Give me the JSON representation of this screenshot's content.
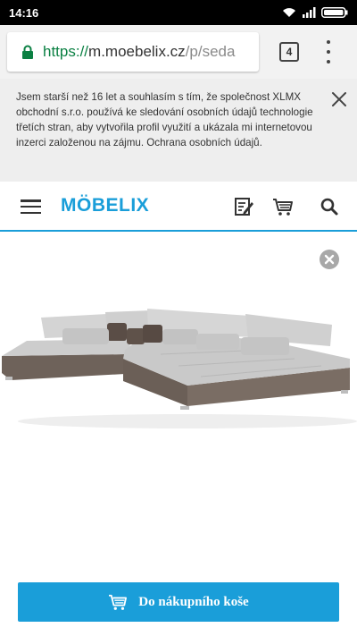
{
  "status_bar": {
    "time": "14:16",
    "icons": [
      "wifi-icon",
      "signal-icon",
      "battery-icon"
    ]
  },
  "browser": {
    "url_scheme": "https://",
    "url_host": "m.moebelix.cz",
    "url_path": "/p/seda",
    "tab_count": "4",
    "icons": [
      "lock-icon",
      "overflow-menu-icon"
    ]
  },
  "cookie_banner": {
    "text": "Jsem starší než 16 let a souhlasím s tím, že společnost XLMX obchodní s.r.o. používá ke sledování osobních údajů technologie třetích stran, aby vytvořila profil využití a ukázala mi internetovou inzerci založenou na zájmu. Ochrana osobních údajů.",
    "close_icon": "close-icon"
  },
  "header": {
    "logo": "MÖBELIX",
    "icons": [
      "hamburger-menu-icon",
      "notepad-icon",
      "cart-icon",
      "search-icon"
    ]
  },
  "product": {
    "close_icon": "close-circle-icon",
    "image": "corner-sofa-image"
  },
  "cart_button": {
    "label": "Do nákupního koše",
    "icon": "cart-icon"
  },
  "colors": {
    "accent": "#1a9ed9",
    "banner_bg": "#eeeeee",
    "browser_bar": "#f2f2f2",
    "secure_green": "#0b8043"
  }
}
